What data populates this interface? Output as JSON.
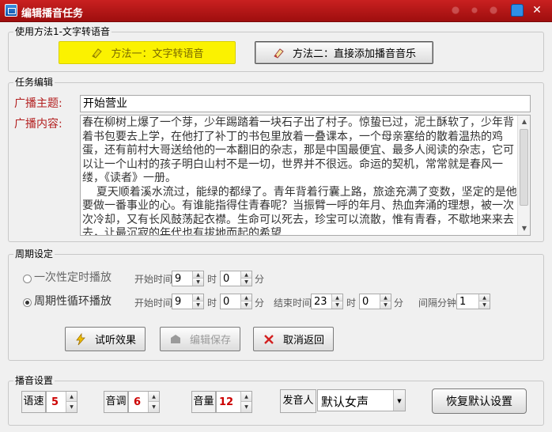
{
  "window": {
    "title": "编辑播音任务",
    "close_glyph": "✕"
  },
  "method_group": {
    "label": "使用方法1-文字转语音",
    "btn1_label": "方法一：文字转语音",
    "btn2_label": "方法二：直接添加播音音乐",
    "btn1_icon": "tts-icon",
    "btn2_icon": "music-icon"
  },
  "task_group": {
    "label": "任务编辑",
    "topic_label": "广播主题:",
    "topic_value": "开始营业",
    "content_label": "广播内容:",
    "content_value": "春在柳树上爆了一个芽，少年踢踏着一块石子出了村子。惊蛰已过，泥土酥软了，少年背着书包要去上学，在他打了补丁的书包里放着一叠课本，一个母亲塞给的散着温热的鸡蛋，还有前村大哥送给他的一本翻旧的杂志，那是中国最便宜、最多人阅读的杂志，它可以让一个山村的孩子明白山村不是一切，世界并不很远。命运的契机，常常就是春风一缕，《读者》一册。\n    夏天顺着溪水流过，能绿的都绿了。青年背着行囊上路，旅途充满了变数，坚定的是他要做一番事业的心。有谁能指得住青春呢？当振臂一呼的年月、热血奔涌的理想，被一次次冷却，又有长风鼓荡起衣襟。生命可以死去，珍宝可以流散，惟有青春，不歇地来来去去，让最沉寂的年代也有拔地而起的希望"
  },
  "cycle_group": {
    "label": "周期设定",
    "once_label": "一次性定时播放",
    "once_selected": false,
    "repeat_label": "周期性循环播放",
    "repeat_selected": true,
    "start_time_label": "开始时间",
    "end_time_label": "结束时间",
    "hour_label": "时",
    "minute_label": "分",
    "interval_label": "间隔分钟",
    "once_start_hour": "9",
    "once_start_min": "0",
    "repeat_start_hour": "9",
    "repeat_start_min": "0",
    "repeat_end_hour": "23",
    "repeat_end_min": "0",
    "interval": "1",
    "btn_preview": "试听效果",
    "btn_save": "编辑保存",
    "btn_cancel": "取消返回"
  },
  "voice_group": {
    "label": "播音设置",
    "speed_label": "语速",
    "speed_value": "5",
    "pitch_label": "音调",
    "pitch_value": "6",
    "volume_label": "音量",
    "volume_value": "12",
    "speaker_label": "发音人",
    "speaker_value": "默认女声",
    "reset_label": "恢复默认设置"
  }
}
